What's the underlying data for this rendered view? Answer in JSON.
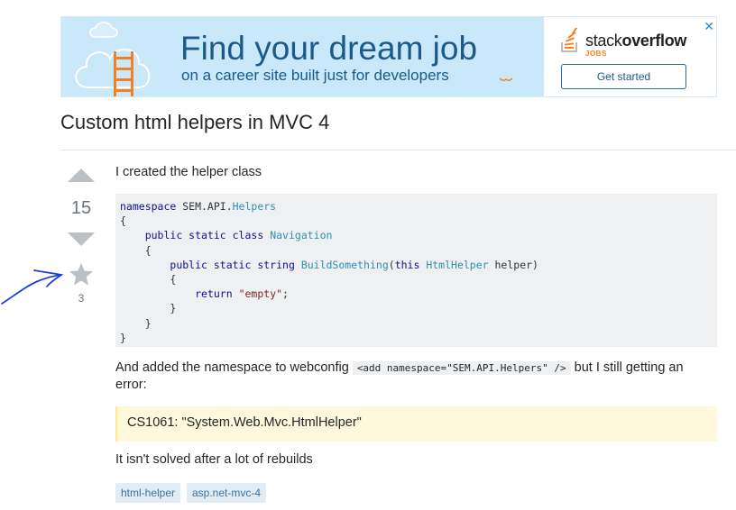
{
  "ad": {
    "headline": "Find your dream job",
    "subline": "on a career site built just for developers",
    "brand_light": "stack",
    "brand_bold": "overflow",
    "brand_sub": "JOBS",
    "cta": "Get started",
    "close": "✕"
  },
  "question": {
    "title": "Custom html helpers in MVC 4",
    "votes": "15",
    "favorites": "3",
    "intro": "I created the helper class",
    "code_lines": [
      "namespace SEM.API.Helpers",
      "{",
      "    public static class Navigation",
      "    {",
      "        public static string BuildSomething(this HtmlHelper helper)",
      "        {",
      "            return \"empty\";",
      "        }",
      "    }",
      "}"
    ],
    "para2_before": "And added the namespace to webconfig ",
    "para2_code": "<add namespace=\"SEM.API.Helpers\" />",
    "para2_after": " but I still getting an",
    "para2_line2": "error:",
    "error_quote": "CS1061: \"System.Web.Mvc.HtmlHelper\"",
    "closing": "It isn't solved after a lot of rebuilds",
    "tags": [
      "html-helper",
      "asp.net-mvc-4"
    ]
  },
  "colors": {
    "accent": "#f48024",
    "link": "#39739d",
    "ad_bg": "#c9e8f9",
    "annotation": "#1a3fd1"
  }
}
